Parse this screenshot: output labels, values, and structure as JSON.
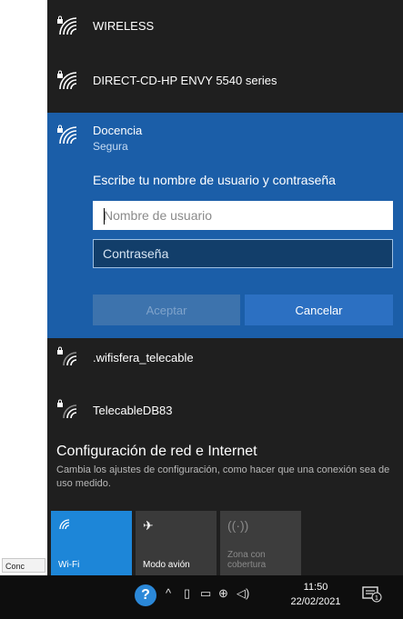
{
  "desktop": {
    "snippet": "",
    "taskbar_label": "Conc"
  },
  "networks": [
    {
      "name": "WIRELESS",
      "secured": true
    },
    {
      "name": "DIRECT-CD-HP ENVY 5540 series",
      "secured": true
    }
  ],
  "active_network": {
    "name": "Docencia",
    "security": "Segura",
    "prompt": "Escribe tu nombre de usuario y contraseña",
    "username_placeholder": "Nombre de usuario",
    "password_placeholder": "Contraseña",
    "accept_label": "Aceptar",
    "cancel_label": "Cancelar"
  },
  "networks_below": [
    {
      "name": ".wifisfera_telecable",
      "secured": true
    },
    {
      "name": "TelecableDB83",
      "secured": true
    }
  ],
  "settings": {
    "title": "Configuración de red e Internet",
    "description": "Cambia los ajustes de configuración, como hacer que una conexión sea de uso medido."
  },
  "quick_actions": [
    {
      "label": "Wi-Fi",
      "icon": "wifi-icon",
      "active": true
    },
    {
      "label": "Modo avión",
      "icon": "airplane-icon",
      "active": false
    },
    {
      "label": "Zona con cobertura",
      "icon": "hotspot-icon",
      "active": false,
      "disabled": true
    }
  ],
  "taskbar": {
    "time": "11:50",
    "date": "22/02/2021",
    "notification_count": "1"
  },
  "colors": {
    "flyout_bg": "#1f1f1f",
    "active_panel_bg": "#1b5ea8",
    "accent": "#1d86d8",
    "taskbar_bg": "#0e0e0e"
  }
}
